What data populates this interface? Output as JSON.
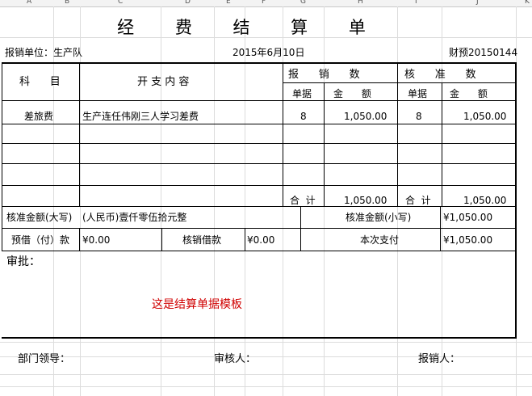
{
  "columns": [
    "A",
    "B",
    "C",
    "D",
    "E",
    "F",
    "G",
    "H",
    "I",
    "J",
    "K"
  ],
  "title": "经 费 结 算 单",
  "unit": "报销单位：生产队",
  "date": "2015年6月10日",
  "voucher_no": "财预20150144",
  "headers": {
    "subject": "科      目",
    "content": "开 支 内 容",
    "report": "报      销      数",
    "approve": "核      准      数",
    "doc": "单据",
    "amount": "金      额"
  },
  "row": {
    "subject": "差旅费",
    "content": "生产连任伟刚三人学习差费",
    "report_docs": "8",
    "report_amount": "1,050.00",
    "approve_docs": "8",
    "approve_amount": "1,050.00"
  },
  "total_label": "合  计",
  "total_report": "1,050.00",
  "total_approve": "1,050.00",
  "approved_upper_label": "核准金额(大写)",
  "approved_upper_value": "(人民币)壹仟零伍拾元整",
  "approved_lower_label": "核准金额(小写)",
  "approved_lower_value": "¥1,050.00",
  "advance_label": "预借（付）款",
  "advance_value": "¥0.00",
  "writeoff_label": "核销借款",
  "writeoff_value": "¥0.00",
  "current_pay_label": "本次支付",
  "current_pay_value": "¥1,050.00",
  "approval_label": "审批：",
  "template_note": "这是结算单据模板",
  "footer": {
    "dept_leader": "部门领导：",
    "reviewer": "审核人：",
    "claimant": "报销人："
  }
}
